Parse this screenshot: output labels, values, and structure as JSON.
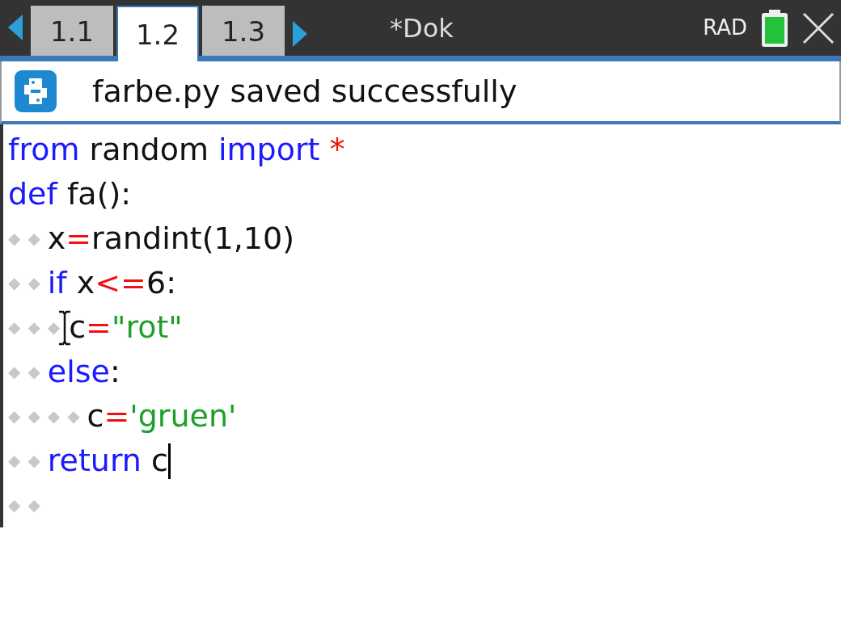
{
  "tabs": [
    {
      "label": "1.1",
      "selected": false
    },
    {
      "label": "1.2",
      "selected": true
    },
    {
      "label": "1.3",
      "selected": false
    }
  ],
  "document_title": "*Dok",
  "angle_mode": "RAD",
  "notification": {
    "text": "farbe.py saved successfully"
  },
  "code_lines": [
    {
      "caret": false,
      "pointer": false,
      "tokens": [
        {
          "text": "from",
          "kind": "keyword"
        },
        {
          "text": " random ",
          "kind": "plain"
        },
        {
          "text": "import",
          "kind": "keyword"
        },
        {
          "text": " *",
          "kind": "op"
        }
      ]
    },
    {
      "caret": false,
      "pointer": false,
      "tokens": [
        {
          "text": "def",
          "kind": "keyword"
        },
        {
          "text": " fa():",
          "kind": "plain"
        }
      ]
    },
    {
      "guides": "◆◆",
      "caret": false,
      "pointer": false,
      "tokens": [
        {
          "text": "x",
          "kind": "plain"
        },
        {
          "text": "=",
          "kind": "op"
        },
        {
          "text": "randint(1,10)",
          "kind": "plain"
        }
      ]
    },
    {
      "guides": "◆◆",
      "caret": false,
      "pointer": false,
      "tokens": [
        {
          "text": "if",
          "kind": "keyword"
        },
        {
          "text": " x",
          "kind": "plain"
        },
        {
          "text": "<=",
          "kind": "op"
        },
        {
          "text": "6:",
          "kind": "plain"
        }
      ]
    },
    {
      "guides": "◆◆◆",
      "caret": false,
      "pointer": true,
      "tokens": [
        {
          "text": "c",
          "kind": "plain"
        },
        {
          "text": "=",
          "kind": "op"
        },
        {
          "text": "\"rot\"",
          "kind": "string"
        }
      ]
    },
    {
      "guides": "◆◆",
      "caret": false,
      "pointer": false,
      "tokens": [
        {
          "text": "else",
          "kind": "keyword"
        },
        {
          "text": ":",
          "kind": "plain"
        }
      ]
    },
    {
      "guides": "◆◆◆◆",
      "caret": false,
      "pointer": false,
      "tokens": [
        {
          "text": "c",
          "kind": "plain"
        },
        {
          "text": "=",
          "kind": "op"
        },
        {
          "text": "'gruen'",
          "kind": "string"
        }
      ]
    },
    {
      "guides": "◆◆",
      "caret": true,
      "pointer": false,
      "tokens": [
        {
          "text": "return",
          "kind": "keyword"
        },
        {
          "text": " c",
          "kind": "plain"
        }
      ]
    },
    {
      "guides": "◆◆",
      "caret": false,
      "pointer": false
    }
  ]
}
